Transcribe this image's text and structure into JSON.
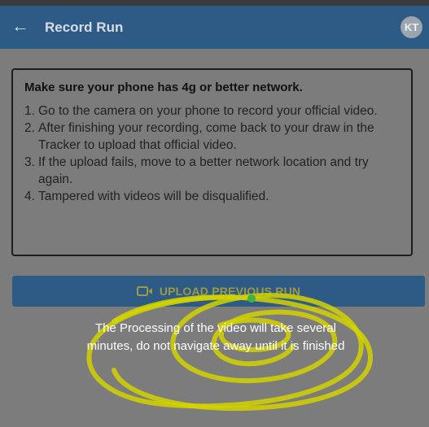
{
  "appbar": {
    "title": "Record Run",
    "avatar_initials": "KT"
  },
  "info": {
    "heading": "Make sure your phone has 4g or better network.",
    "steps": [
      {
        "num": "1.",
        "text": "Go to the camera on your phone to record your official video."
      },
      {
        "num": "2.",
        "text": "After finishing your recording, come back to your draw in the Tracker to upload that official video."
      },
      {
        "num": "3.",
        "text": "If the upload fails, move to a better network location and try again."
      },
      {
        "num": "4.",
        "text": "Tampered with videos will be disqualified."
      }
    ]
  },
  "upload_button": {
    "label": "UPLOAD PREVIOUS RUN",
    "icon": "video-camera-icon"
  },
  "processing_message": "The Processing of the video will take several minutes, do not navigate away until it is finished",
  "colors": {
    "appbar": "#2e5a86",
    "overlay": "#7c7c7c",
    "annotation": "#d4d400"
  }
}
